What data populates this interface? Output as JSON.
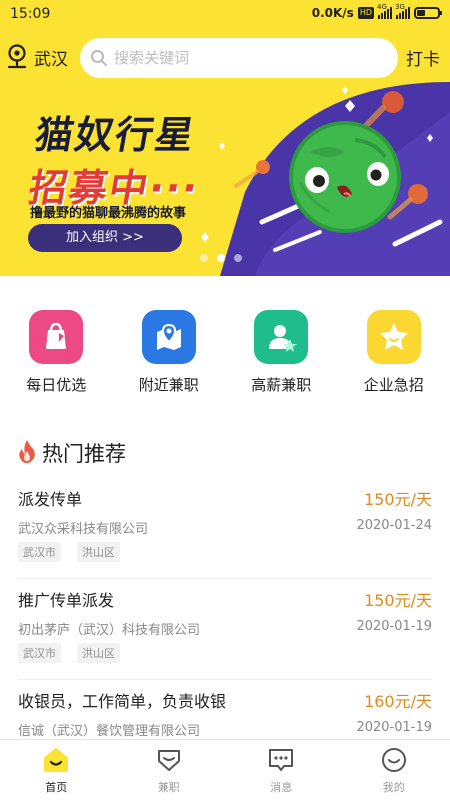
{
  "status_bar": {
    "time": "15:09",
    "speed": "0.0K/s",
    "hd": "HD",
    "net1": "4G",
    "net2": "3G"
  },
  "header": {
    "location": "武汉",
    "search_placeholder": "搜索关键词",
    "clockin": "打卡"
  },
  "banner": {
    "title": "猫奴行星",
    "subtitle": "招募中···",
    "tagline": "撸最野的猫聊最沸腾的故事",
    "button": "加入组织  >>",
    "slide_count": 3,
    "active_slide": 2
  },
  "quick_entries": [
    {
      "label": "每日优选",
      "icon": "shopping-bag-icon",
      "color": "#ec4a85"
    },
    {
      "label": "附近兼职",
      "icon": "map-location-icon",
      "color": "#2a78e4"
    },
    {
      "label": "高薪兼职",
      "icon": "user-star-icon",
      "color": "#1fbd8b"
    },
    {
      "label": "企业急招",
      "icon": "star-face-icon",
      "color": "#fbd731"
    }
  ],
  "section": {
    "title": "热门推荐",
    "icon": "flame-icon",
    "icon_color": "#ee5a3f"
  },
  "jobs": [
    {
      "title": "派发传单",
      "pay": "150元/天",
      "company": "武汉众采科技有限公司",
      "date": "2020-01-24",
      "tags": [
        "武汉市",
        "洪山区"
      ]
    },
    {
      "title": "推广传单派发",
      "pay": "150元/天",
      "company": "初出茅庐（武汉）科技有限公司",
      "date": "2020-01-19",
      "tags": [
        "武汉市",
        "洪山区"
      ]
    },
    {
      "title": "收银员，工作简单，负责收银",
      "pay": "160元/天",
      "company": "信诚（武汉）餐饮管理有限公司",
      "date": "2020-01-19",
      "tags": []
    }
  ],
  "tabs": [
    {
      "label": "首页",
      "icon": "home-smile-icon",
      "active": true
    },
    {
      "label": "兼职",
      "icon": "badge-icon",
      "active": false
    },
    {
      "label": "消息",
      "icon": "message-icon",
      "active": false
    },
    {
      "label": "我的",
      "icon": "profile-smile-icon",
      "active": false
    }
  ],
  "colors": {
    "brand_yellow": "#fce233",
    "pay_orange": "#e08a1e",
    "banner_purple": "#4a35a8"
  }
}
